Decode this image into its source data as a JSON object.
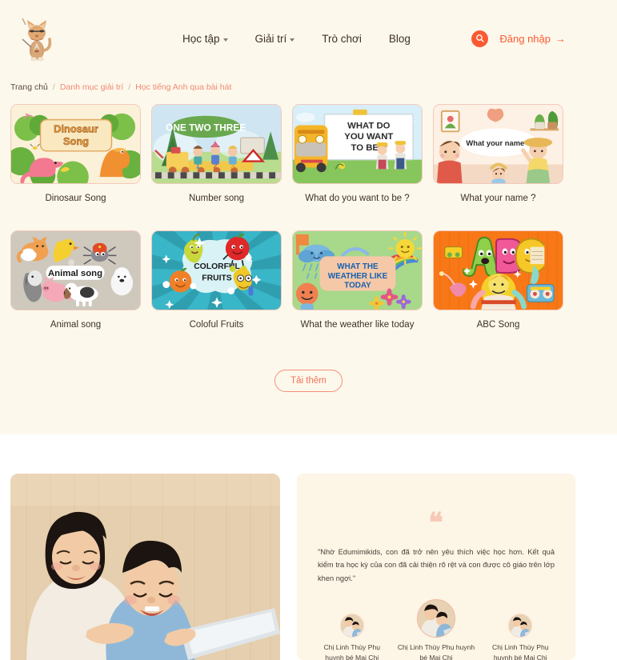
{
  "header": {
    "logo_icon": "cat-mascot-logo",
    "nav": [
      {
        "label": "Học tập",
        "has_caret": true
      },
      {
        "label": "Giải trí",
        "has_caret": true
      },
      {
        "label": "Trò chơi",
        "has_caret": false
      },
      {
        "label": "Blog",
        "has_caret": false
      }
    ],
    "search_icon": "search-icon",
    "login_label": "Đăng nhập",
    "login_arrow": "→"
  },
  "breadcrumb": {
    "home": "Trang chủ",
    "sep": "/",
    "category": "Danh mục giải trí",
    "current": "Học tiếng Anh qua bài hát"
  },
  "cards": [
    {
      "title": "Dinosaur Song",
      "art": "dinosaur"
    },
    {
      "title": "Number song",
      "art": "train"
    },
    {
      "title": "What do you want to be ?",
      "art": "bus"
    },
    {
      "title": "What your name ?",
      "art": "name"
    },
    {
      "title": "Animal song",
      "art": "animals"
    },
    {
      "title": "Coloful Fruits",
      "art": "fruits"
    },
    {
      "title": "What the weather like today",
      "art": "weather"
    },
    {
      "title": "ABC Song",
      "art": "abc"
    }
  ],
  "card_art_text": {
    "dinosaur_line1": "Dinosaur",
    "dinosaur_line2": "Song",
    "train_title": "ONE TWO THREE",
    "train_numbers": [
      "1",
      "2",
      "3"
    ],
    "bus_line1": "WHAT DO",
    "bus_line2": "YOU WANT",
    "bus_line3": "TO BE ?",
    "name_bubble": "What your name ?",
    "animals_label": "Animal song",
    "fruits_line1": "COLORFUL",
    "fruits_line2": "FRUITS",
    "weather_line1": "WHAT THE",
    "weather_line2": "WEATHER LIKE",
    "weather_line3": "TODAY",
    "abc_letters": "ABC"
  },
  "load_more": "Tải thêm",
  "testimonial": {
    "quote_mark": "❝",
    "text": "\"Nhờ Edumimikids, con đã trở nên yêu thích việc học hơn. Kết quả kiểm tra học kỳ của con đã cải thiện rõ rệt và con được cô giáo trên lớp khen ngợi.\"",
    "authors": [
      {
        "name": "Chị Linh Thùy Phụ huynh bé Mai Chi"
      },
      {
        "name": "Chị Linh Thùy Phụ huynh bé Mai Chi"
      },
      {
        "name": "Chị Linh Thùy Phụ huynh bé Mai Chi"
      }
    ]
  },
  "colors": {
    "page_bg": "#fdf8ec",
    "accent": "#fa5a32",
    "accent_soft": "#f4907a",
    "text": "#3d3027",
    "quote_bg": "#fdf5e6"
  }
}
